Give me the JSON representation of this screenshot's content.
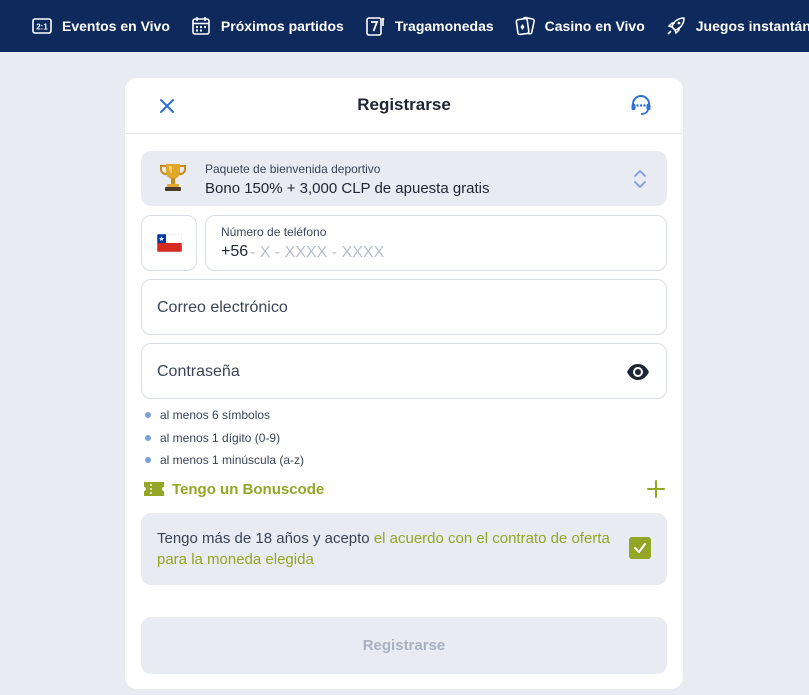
{
  "nav": {
    "items": [
      {
        "label": "Eventos en Vivo",
        "icon": "score-icon"
      },
      {
        "label": "Próximos partidos",
        "icon": "calendar-icon"
      },
      {
        "label": "Tragamonedas",
        "icon": "slot-seven-icon"
      },
      {
        "label": "Casino en Vivo",
        "icon": "cards-icon"
      },
      {
        "label": "Juegos instantáneos",
        "icon": "rocket-icon"
      }
    ]
  },
  "modal": {
    "title": "Registrarse",
    "close_icon": "close-icon",
    "support_icon": "headset-icon"
  },
  "bonus": {
    "caption": "Paquete de bienvenida deportivo",
    "value": "Bono 150% + 3,000 CLP de apuesta gratis",
    "icon": "trophy-icon"
  },
  "phone": {
    "country_flag": "chile-flag",
    "label": "Número de teléfono",
    "prefix": "+56",
    "placeholder": "- X - XXXX - XXXX"
  },
  "email": {
    "placeholder": "Correo electrónico"
  },
  "password": {
    "placeholder": "Contraseña",
    "rules": [
      "al menos 6 símbolos",
      "al menos 1 dígito (0-9)",
      "al menos 1 minúscula (a-z)"
    ]
  },
  "bonuscode": {
    "label": "Tengo un Bonuscode"
  },
  "agreement": {
    "text": "Tengo más de 18 años y acepto ",
    "link": "el acuerdo con el contrato de oferta para la moneda elegida",
    "checked": true
  },
  "submit": {
    "label": "Registrarse"
  },
  "colors": {
    "nav_bg": "#0e2a5c",
    "page_bg": "#e8ebf1",
    "accent": "#93a626",
    "icon_blue": "#2f6fd6"
  }
}
